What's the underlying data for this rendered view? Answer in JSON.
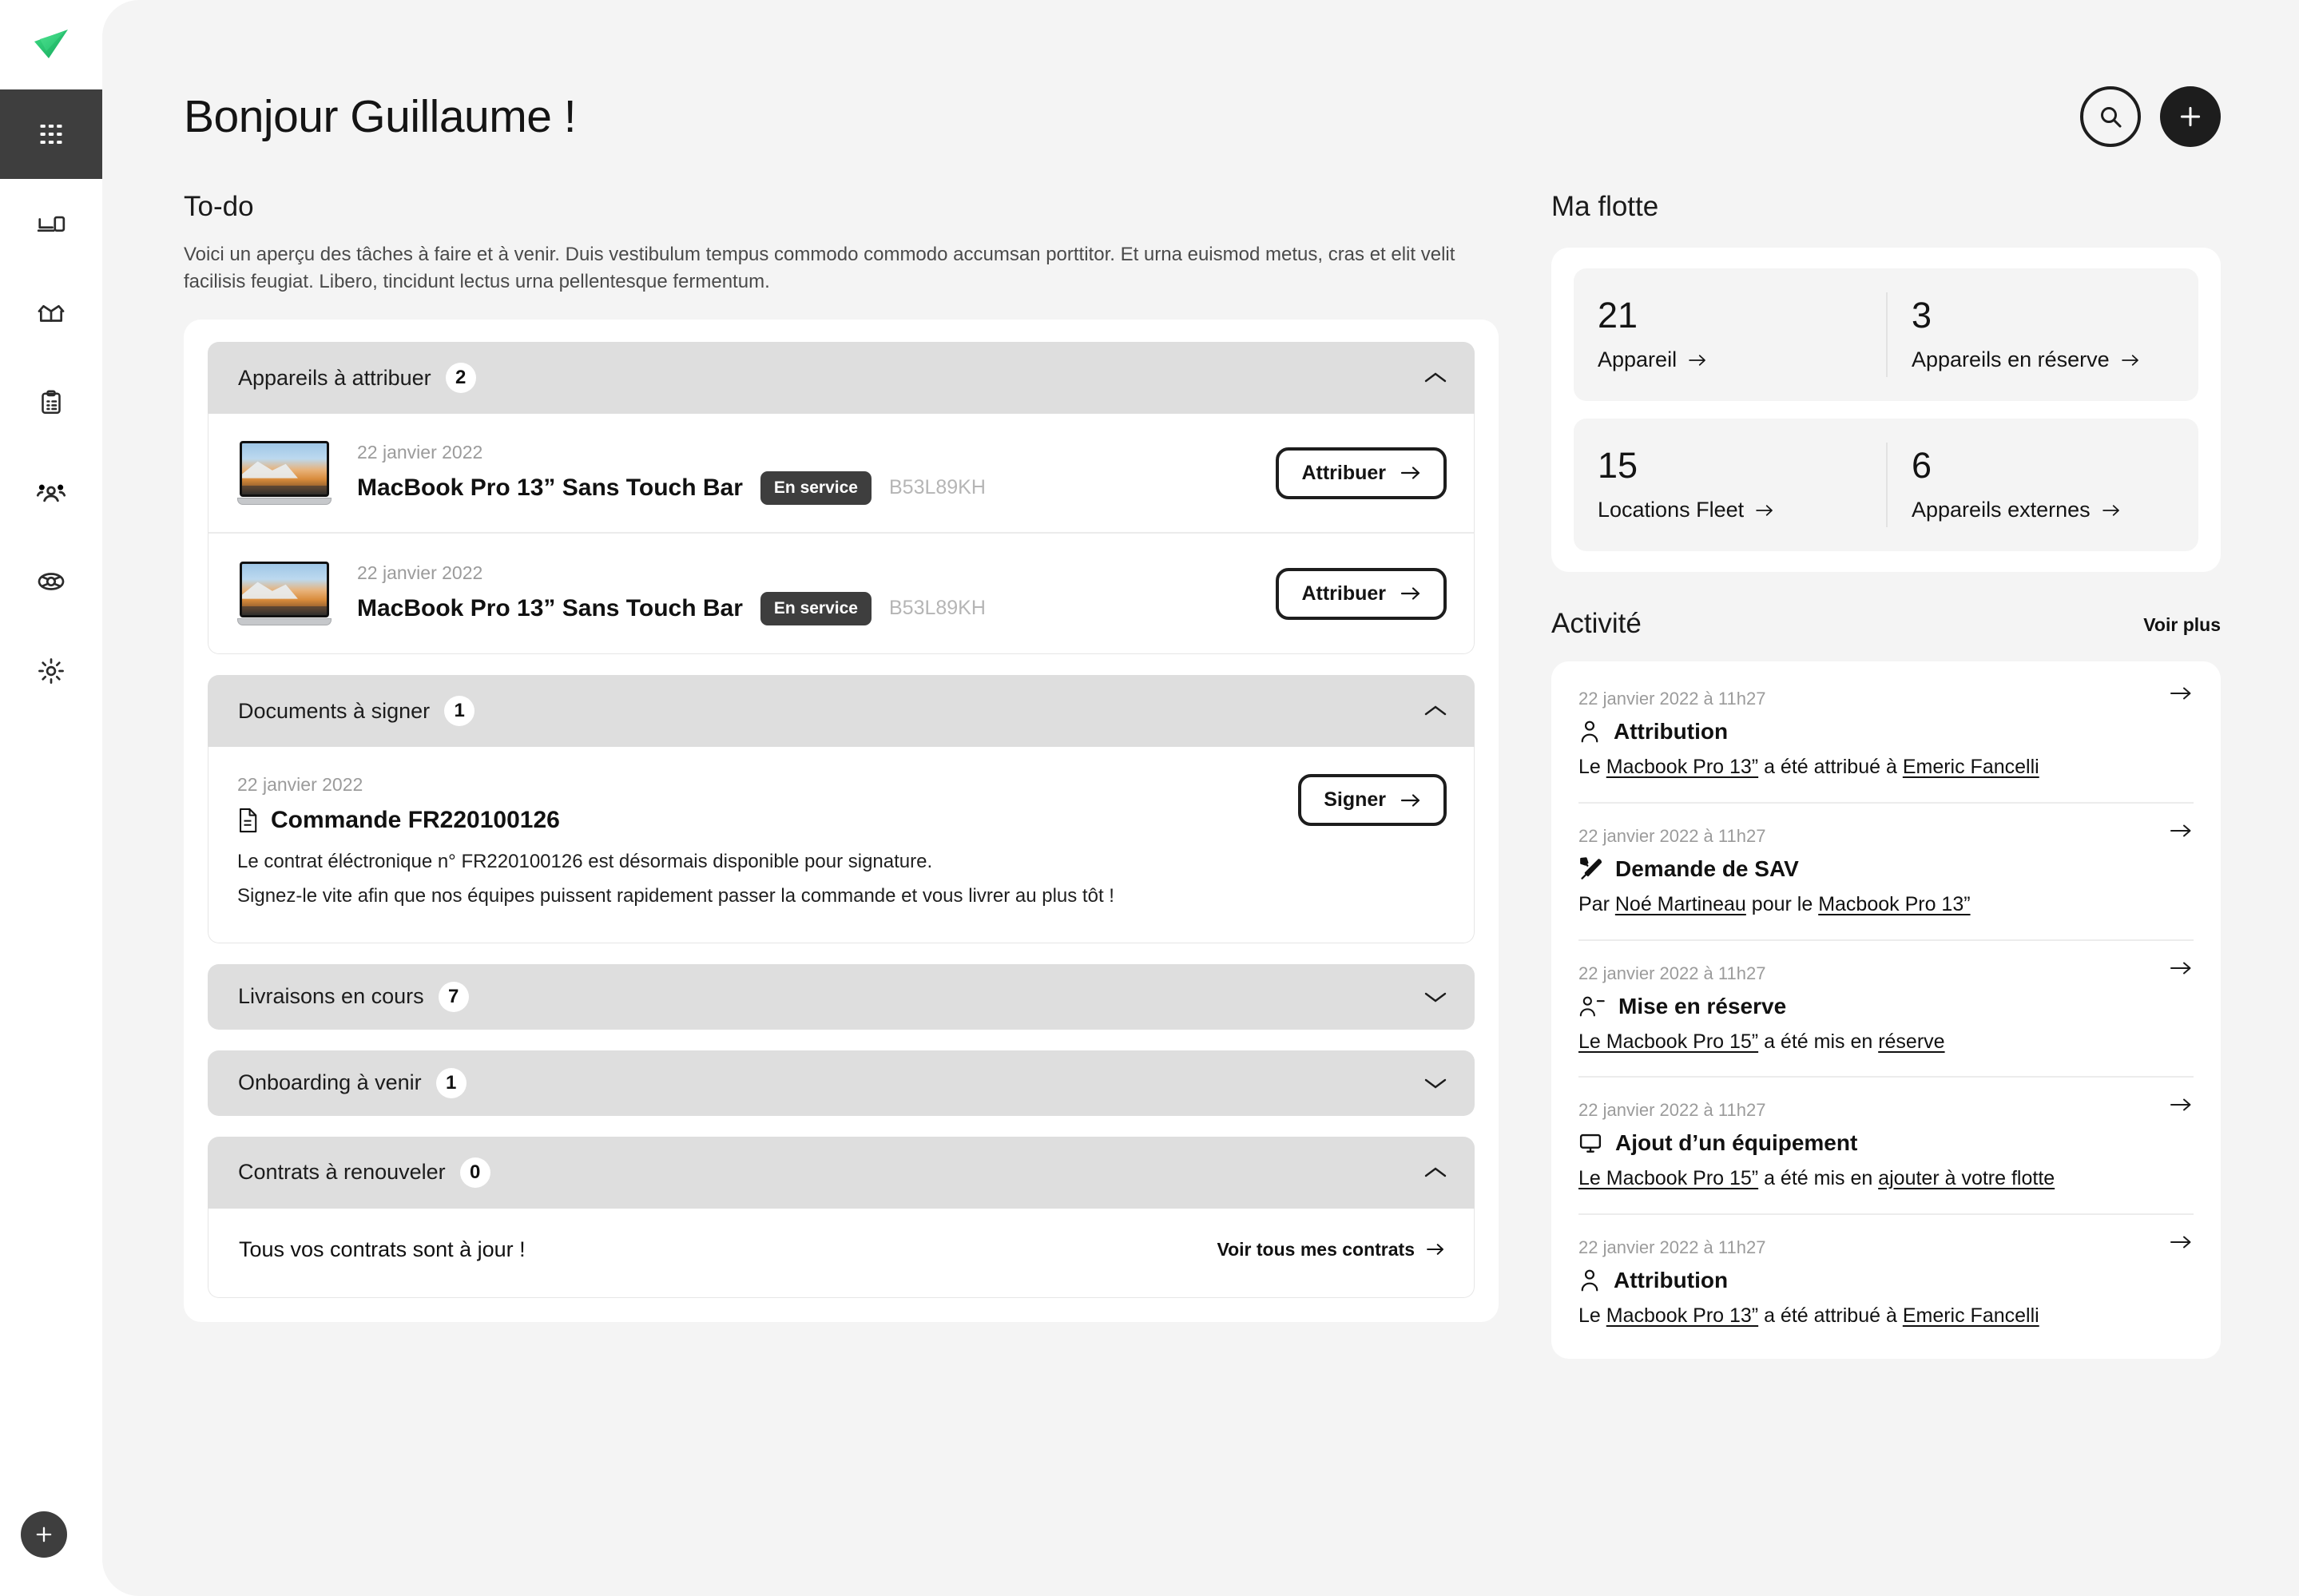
{
  "brand": {
    "logo_name": "paper-plane-logo",
    "accent": "#2ecc71",
    "dark": "#3e3e3e"
  },
  "sidebar": {
    "items": [
      {
        "icon": "grid-apps-icon",
        "name": "dashboard",
        "active": true
      },
      {
        "icon": "devices-icon",
        "name": "devices",
        "active": false
      },
      {
        "icon": "open-box-icon",
        "name": "deliveries",
        "active": false
      },
      {
        "icon": "clipboard-icon",
        "name": "contracts",
        "active": false
      },
      {
        "icon": "people-icon",
        "name": "collaborators",
        "active": false
      },
      {
        "icon": "lifebuoy-icon",
        "name": "support",
        "active": false
      },
      {
        "icon": "gear-icon",
        "name": "settings",
        "active": false
      }
    ],
    "fab_icon": "plus-icon"
  },
  "header": {
    "greeting": "Bonjour Guillaume !",
    "search_icon": "search-icon",
    "add_icon": "plus-icon"
  },
  "todo": {
    "title": "To-do",
    "description": "Voici un aperçu des tâches à faire et à venir. Duis vestibulum tempus commodo commodo accumsan porttitor. Et urna euismod metus, cras et elit velit facilisis feugiat. Libero, tincidunt lectus urna pellentesque fermentum.",
    "sections": [
      {
        "id": "appareils-a-attribuer",
        "title": "Appareils à attribuer",
        "count": "2",
        "expanded": true,
        "chevron": "chevron-up-icon",
        "devices": [
          {
            "date": "22 janvier 2022",
            "name": "MacBook Pro 13” Sans Touch Bar",
            "status": "En service",
            "serial": "B53L89KH",
            "action_label": "Attribuer"
          },
          {
            "date": "22 janvier 2022",
            "name": "MacBook Pro 13” Sans Touch Bar",
            "status": "En service",
            "serial": "B53L89KH",
            "action_label": "Attribuer"
          }
        ]
      },
      {
        "id": "documents-a-signer",
        "title": "Documents à signer",
        "count": "1",
        "expanded": true,
        "chevron": "chevron-up-icon",
        "document": {
          "date": "22 janvier 2022",
          "icon": "document-icon",
          "title": "Commande FR220100126",
          "line1": "Le contrat éléctronique n° FR220100126 est désormais disponible pour signature.",
          "line2": "Signez-le vite afin que nos équipes puissent rapidement passer la commande et vous livrer au plus tôt !",
          "action_label": "Signer"
        }
      },
      {
        "id": "livraisons-en-cours",
        "title": "Livraisons en cours",
        "count": "7",
        "expanded": false,
        "chevron": "chevron-down-icon"
      },
      {
        "id": "onboarding-a-venir",
        "title": "Onboarding à venir",
        "count": "1",
        "expanded": false,
        "chevron": "chevron-down-icon"
      },
      {
        "id": "contrats-a-renouveler",
        "title": "Contrats à renouveler",
        "count": "0",
        "expanded": true,
        "chevron": "chevron-up-icon",
        "empty_text": "Tous vos contrats sont à jour !",
        "empty_link": "Voir tous mes contrats"
      }
    ]
  },
  "fleet": {
    "title": "Ma flotte",
    "rows": [
      [
        {
          "value": "21",
          "label": "Appareil"
        },
        {
          "value": "3",
          "label": "Appareils en réserve"
        }
      ],
      [
        {
          "value": "15",
          "label": "Locations Fleet"
        },
        {
          "value": "6",
          "label": "Appareils externes"
        }
      ]
    ]
  },
  "activity": {
    "title": "Activité",
    "see_more": "Voir plus",
    "items": [
      {
        "date": "22 janvier 2022 à 11h27",
        "icon": "person-icon",
        "title": "Attribution",
        "parts": [
          {
            "t": "Le ",
            "u": false
          },
          {
            "t": "Macbook Pro 13”",
            "u": true
          },
          {
            "t": " a été attribué à ",
            "u": false
          },
          {
            "t": "Emeric Fancelli",
            "u": true
          }
        ]
      },
      {
        "date": "22 janvier 2022 à 11h27",
        "icon": "tools-icon",
        "title": "Demande de SAV",
        "parts": [
          {
            "t": "Par ",
            "u": false
          },
          {
            "t": "Noé Martineau",
            "u": true
          },
          {
            "t": " pour le ",
            "u": false
          },
          {
            "t": "Macbook Pro 13”",
            "u": true
          }
        ]
      },
      {
        "date": "22 janvier 2022 à 11h27",
        "icon": "person-minus-icon",
        "title": "Mise en réserve",
        "parts": [
          {
            "t": "Le Macbook Pro 15”",
            "u": true
          },
          {
            "t": " a été mis en ",
            "u": false
          },
          {
            "t": "réserve",
            "u": true
          }
        ]
      },
      {
        "date": "22 janvier 2022 à 11h27",
        "icon": "monitor-icon",
        "title": "Ajout d’un équipement",
        "parts": [
          {
            "t": "Le Macbook Pro 15”",
            "u": true
          },
          {
            "t": " a été mis en ",
            "u": false
          },
          {
            "t": "ajouter à votre flotte",
            "u": true
          }
        ]
      },
      {
        "date": "22 janvier 2022 à 11h27",
        "icon": "person-icon",
        "title": "Attribution",
        "parts": [
          {
            "t": "Le ",
            "u": false
          },
          {
            "t": "Macbook Pro 13”",
            "u": true
          },
          {
            "t": " a été attribué à ",
            "u": false
          },
          {
            "t": "Emeric Fancelli",
            "u": true
          }
        ]
      }
    ]
  }
}
